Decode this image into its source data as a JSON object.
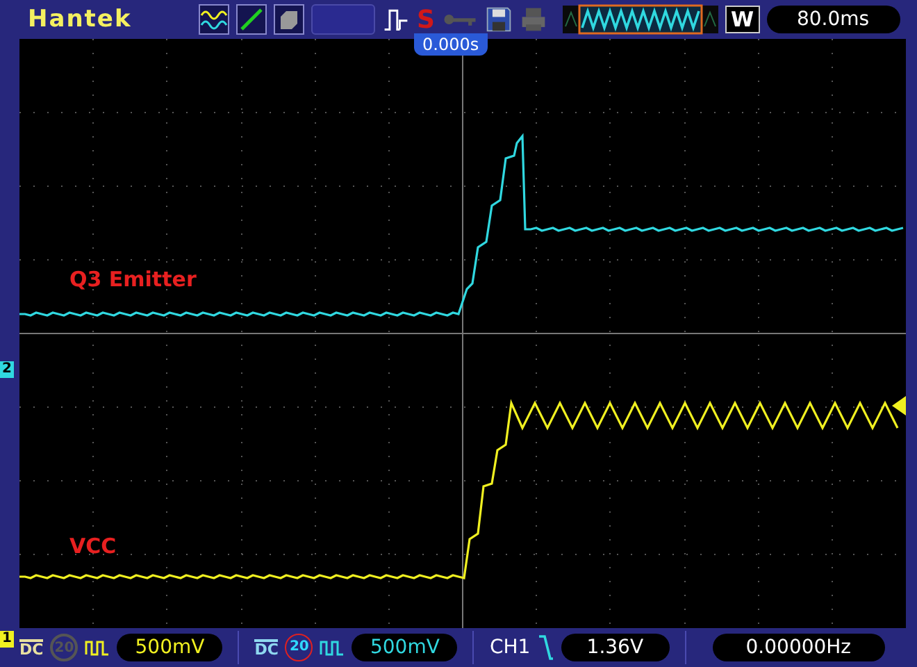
{
  "top_bar": {
    "brand": "Hantek",
    "run_state": "S",
    "timebase": "80.0ms",
    "window_mode": "W"
  },
  "trigger_position": "0.000s",
  "channels": [
    {
      "number": "2",
      "label": "Q3 Emitter",
      "color": "#30d8e0"
    },
    {
      "number": "1",
      "label": "VCC",
      "color": "#f0f020"
    }
  ],
  "channel_settings": [
    {
      "coupling": "DC",
      "bandwidth_limit": "20",
      "bw_limit_on": false,
      "volts_per_div": "500mV",
      "color": "#f0f020"
    },
    {
      "coupling": "DC",
      "bandwidth_limit": "20",
      "bw_limit_on": true,
      "volts_per_div": "500mV",
      "color": "#30d8e0"
    }
  ],
  "trigger": {
    "source": "CH1",
    "level": "1.36V"
  },
  "frequency": "0.00000Hz"
}
